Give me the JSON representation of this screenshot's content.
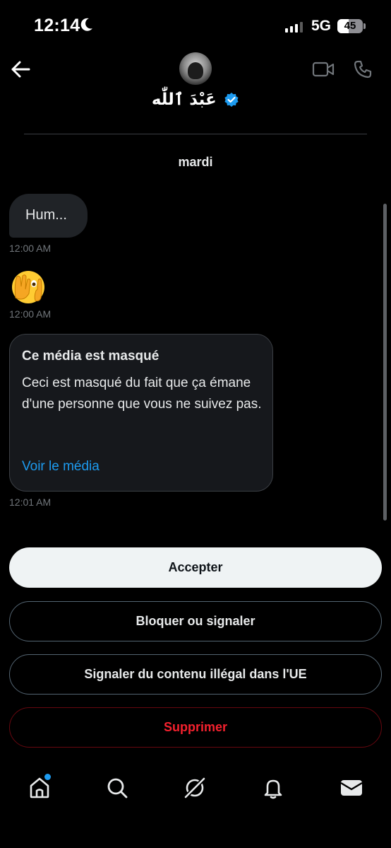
{
  "status_bar": {
    "time": "12:14",
    "network": "5G",
    "battery": "45"
  },
  "header": {
    "contact_name": "عَبْدَ ٱللّٰه"
  },
  "conversation": {
    "day_label": "mardi",
    "messages": [
      {
        "text": "Hum...",
        "time": "12:00 AM"
      },
      {
        "emoji": "🫣",
        "time": "12:00 AM"
      },
      {
        "media_title": "Ce média est masqué",
        "media_text": "Ceci est masqué du fait que ça émane d'une personne que vous ne suivez pas.",
        "media_link": "Voir le média",
        "time": "12:01 AM"
      }
    ]
  },
  "actions": {
    "accept": "Accepter",
    "block": "Bloquer ou signaler",
    "report_eu": "Signaler du contenu illégal dans l'UE",
    "delete": "Supprimer"
  },
  "tab_bar": {
    "items": [
      "home-icon",
      "search-icon",
      "grok-icon",
      "notifications-icon",
      "messages-icon"
    ]
  },
  "colors": {
    "accent": "#1d9bf0",
    "danger": "#f4212e",
    "background": "#000000"
  }
}
